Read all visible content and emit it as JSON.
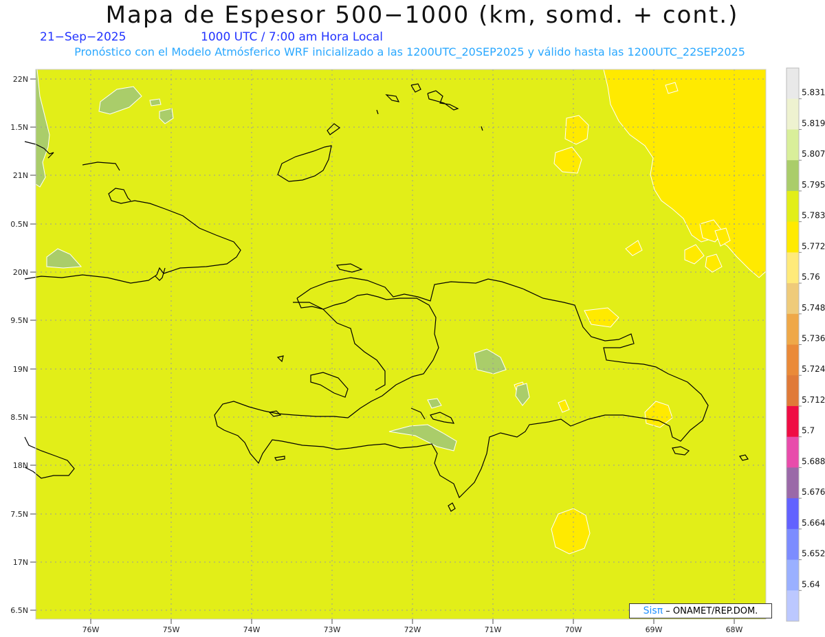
{
  "header": {
    "title": "Mapa de Espesor 500−1000 (km, somd. + cont.)",
    "date": "21−Sep−2025",
    "time": "1000 UTC / 7:00 am Hora Local",
    "subtitle": "Pronóstico con el Modelo Atmósferico WRF inicializado a las 1200UTC_20SEP2025 y válido hasta las  1200UTC_22SEP2025"
  },
  "axes": {
    "lat_labels": [
      "22N",
      "1.5N",
      "21N",
      "0.5N",
      "20N",
      "9.5N",
      "19N",
      "8.5N",
      "18N",
      "7.5N",
      "17N",
      "6.5N"
    ],
    "lon_labels": [
      "76W",
      "75W",
      "74W",
      "73W",
      "72W",
      "71W",
      "70W",
      "69W",
      "68W"
    ]
  },
  "colorbar": {
    "labels": [
      "5.831",
      "5.819",
      "5.807",
      "5.795",
      "5.783",
      "5.772",
      "5.76",
      "5.748",
      "5.736",
      "5.724",
      "5.712",
      "5.7",
      "5.688",
      "5.676",
      "5.664",
      "5.652",
      "5.64"
    ],
    "colors": [
      "#e9e9e9",
      "#eef2d0",
      "#d9ef9a",
      "#aacd6a",
      "#e2ee18",
      "#ffea00",
      "#ffea7a",
      "#efcb7a",
      "#efa848",
      "#ea8a38",
      "#e07a38",
      "#ef0c44",
      "#e84cab",
      "#9a69a8",
      "#6262ff",
      "#7c8cff",
      "#9ab0ff",
      "#bcc8ff"
    ]
  },
  "field_colors": {
    "base": "#e2ee18",
    "high": "#ffea00",
    "low": "#aacd6a"
  },
  "credit": {
    "sis": "Sisπ",
    "org": "– ONAMET/REP.DOM."
  }
}
